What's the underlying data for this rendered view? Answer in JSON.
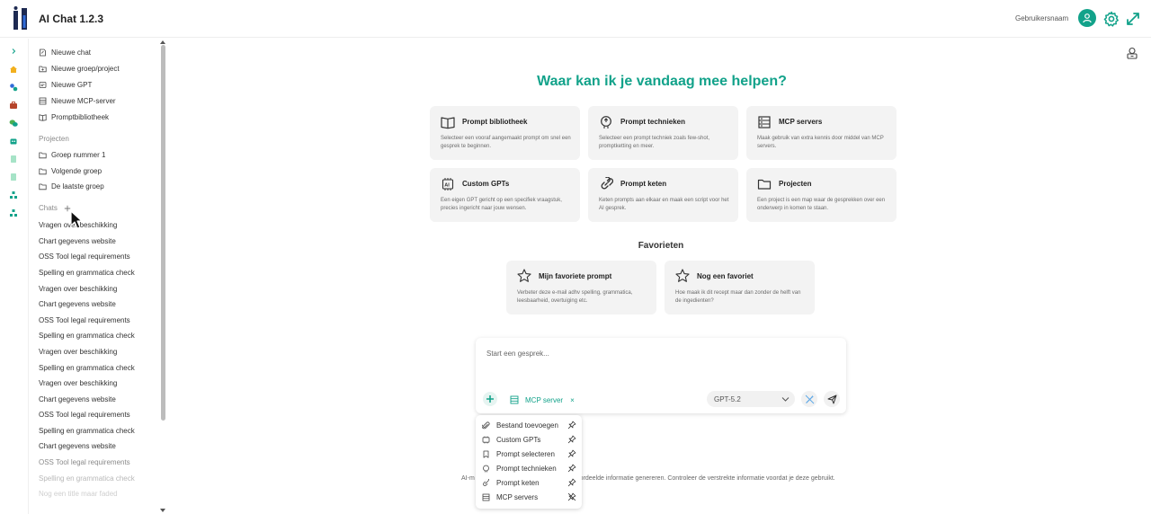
{
  "app": {
    "title": "AI Chat 1.2.3"
  },
  "header": {
    "username": "Gebruikersnaam"
  },
  "colors": {
    "accent": "#12a28a",
    "card_bg": "#f3f3f3"
  },
  "sidebar": {
    "actions": [
      {
        "label": "Nieuwe chat",
        "icon": "new-chat-icon"
      },
      {
        "label": "Nieuwe groep/project",
        "icon": "folder-plus-icon"
      },
      {
        "label": "Nieuwe GPT",
        "icon": "gpt-icon"
      },
      {
        "label": "Nieuwe MCP-server",
        "icon": "server-icon"
      },
      {
        "label": "Promptbibliotheek",
        "icon": "book-icon"
      }
    ],
    "projects_label": "Projecten",
    "projects": [
      "Groep nummer 1",
      "Volgende groep",
      "De laatste groep"
    ],
    "chats_label": "Chats",
    "chats": [
      "Vragen over beschikking",
      "Chart gegevens website",
      "OSS Tool legal requirements",
      "Spelling en grammatica check",
      "Vragen over beschikking",
      "Chart gegevens website",
      "OSS Tool legal requirements",
      "Spelling en grammatica check",
      "Vragen over beschikking",
      "Spelling en grammatica check",
      "Vragen over beschikking",
      "Chart gegevens website",
      "OSS Tool legal requirements",
      "Spelling en grammatica check",
      "Chart gegevens website",
      "OSS Tool legal requirements",
      "Spelling en grammatica check",
      "Nog een title maar faded"
    ]
  },
  "main": {
    "headline": "Waar kan ik je vandaag mee helpen?",
    "cards": [
      {
        "title": "Prompt bibliotheek",
        "desc": "Selecteer een vooraf aangemaakt prompt om snel een gesprek te beginnen.",
        "icon": "book-icon"
      },
      {
        "title": "Prompt technieken",
        "desc": "Selecteer een prompt techniek zoals few-shot, promptketting en meer.",
        "icon": "bulb-icon"
      },
      {
        "title": "MCP servers",
        "desc": "Maak gebruik van extra kennis door middel van MCP servers.",
        "icon": "server-icon"
      },
      {
        "title": "Custom GPTs",
        "desc": "Een eigen GPT gericht op een specifiek vraagstuk, precies ingericht naar jouw wensen.",
        "icon": "ai-chip-icon"
      },
      {
        "title": "Prompt keten",
        "desc": "Keten prompts aan elkaar en maak een script voor het AI gesprek.",
        "icon": "link-icon"
      },
      {
        "title": "Projecten",
        "desc": "Een project is een map waar de gesprekken over een onderwerp in komen te staan.",
        "icon": "folder-icon"
      }
    ],
    "favorites_title": "Favorieten",
    "favorites": [
      {
        "title": "Mijn favoriete prompt",
        "desc": "Verbeter deze e-mail adhv spelling, grammatica, leesbaarheid, overtuiging etc."
      },
      {
        "title": "Nog een favoriet",
        "desc": "Hoe maak ik dit recept maar dan zonder de helft van de ingedienten?"
      }
    ]
  },
  "chat": {
    "placeholder": "Start een gesprek...",
    "chip": "MCP server",
    "chip_close": "×",
    "model": "GPT-5.2"
  },
  "popup": {
    "items": [
      {
        "label": "Bestand toevoegen",
        "icon": "paperclip-icon"
      },
      {
        "label": "Custom GPTs",
        "icon": "ai-chip-icon"
      },
      {
        "label": "Prompt selecteren",
        "icon": "bookmark-icon"
      },
      {
        "label": "Prompt technieken",
        "icon": "bulb-icon"
      },
      {
        "label": "Prompt keten",
        "icon": "link-icon"
      },
      {
        "label": "MCP servers",
        "icon": "server-icon"
      }
    ]
  },
  "footer": {
    "disclaimer_start": "AI-m",
    "disclaimer_end": "oordeelde informatie genereren. Controleer de verstrekte informatie voordat je deze gebruikt."
  }
}
